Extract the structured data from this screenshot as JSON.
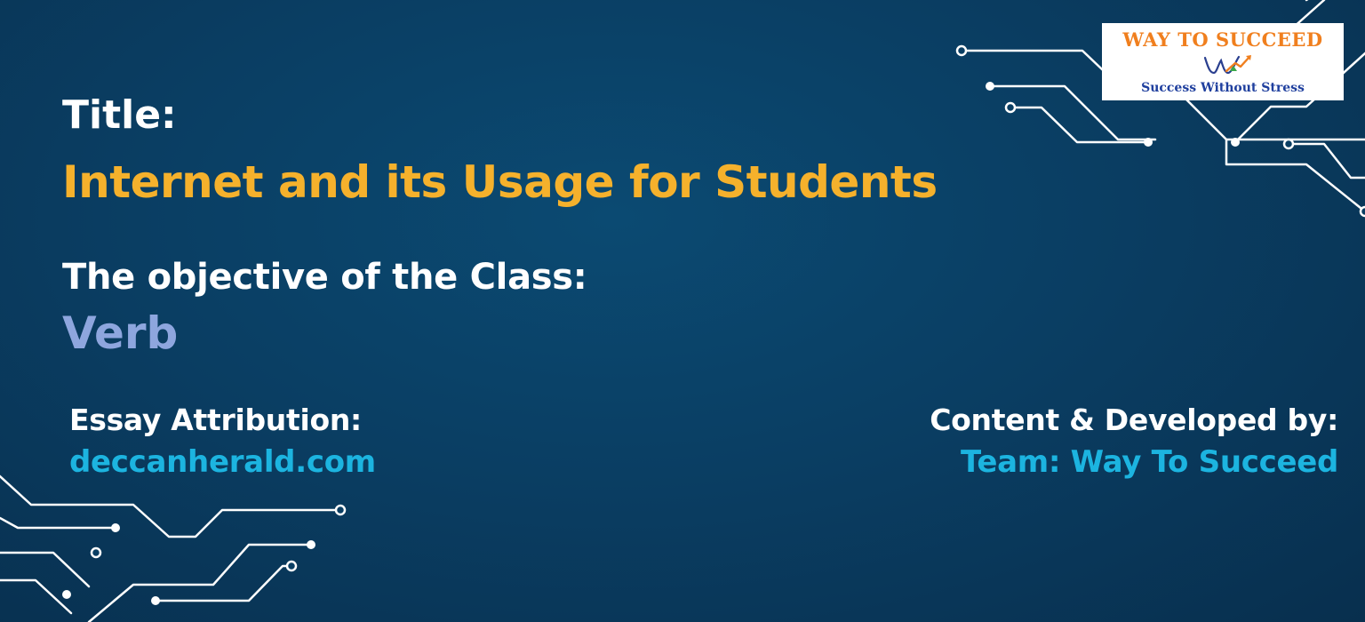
{
  "title": {
    "label": "Title:",
    "value": "Internet and its Usage for Students"
  },
  "objective": {
    "label": "The objective of the Class:",
    "value": "Verb"
  },
  "attribution": {
    "label": "Essay Attribution:",
    "value": "deccanherald.com"
  },
  "developer": {
    "label": "Content & Developed by:",
    "value": "Team: Way To Succeed"
  },
  "logo": {
    "brand": "WAY TO SUCCEED",
    "tagline": "Success Without Stress",
    "icon": "wts-monogram-icon"
  },
  "colors": {
    "background": "#0a3e63",
    "title_accent": "#f5b12c",
    "objective_accent": "#8ea6de",
    "link_accent": "#1cb4e0",
    "logo_orange": "#f07f1e",
    "logo_blue": "#1f3f9e"
  }
}
